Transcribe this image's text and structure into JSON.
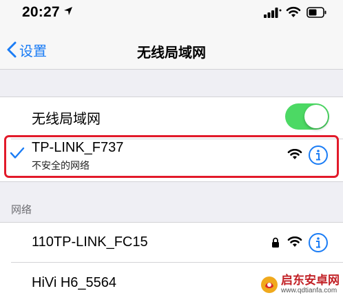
{
  "status_bar": {
    "time": "20:27",
    "icons": [
      "location-arrow-icon",
      "cellular-signal-icon",
      "wifi-icon",
      "battery-icon"
    ]
  },
  "nav": {
    "back_label": "设置",
    "title": "无线局域网"
  },
  "wlan_toggle": {
    "label": "无线局域网",
    "on": true,
    "color": "#4cd964"
  },
  "connected_network": {
    "name": "TP-LINK_F737",
    "subtitle": "不安全的网络",
    "selected": true
  },
  "section_header": "网络",
  "networks": [
    {
      "name": "110TP-LINK_FC15",
      "locked": true
    },
    {
      "name": "HiVi H6_5564",
      "locked": false
    }
  ],
  "colors": {
    "accent": "#1a7cf5",
    "highlight": "#e21a2a",
    "background": "#efeff4"
  },
  "watermark": {
    "title": "启东安卓网",
    "url": "www.qdtianfa.com"
  }
}
